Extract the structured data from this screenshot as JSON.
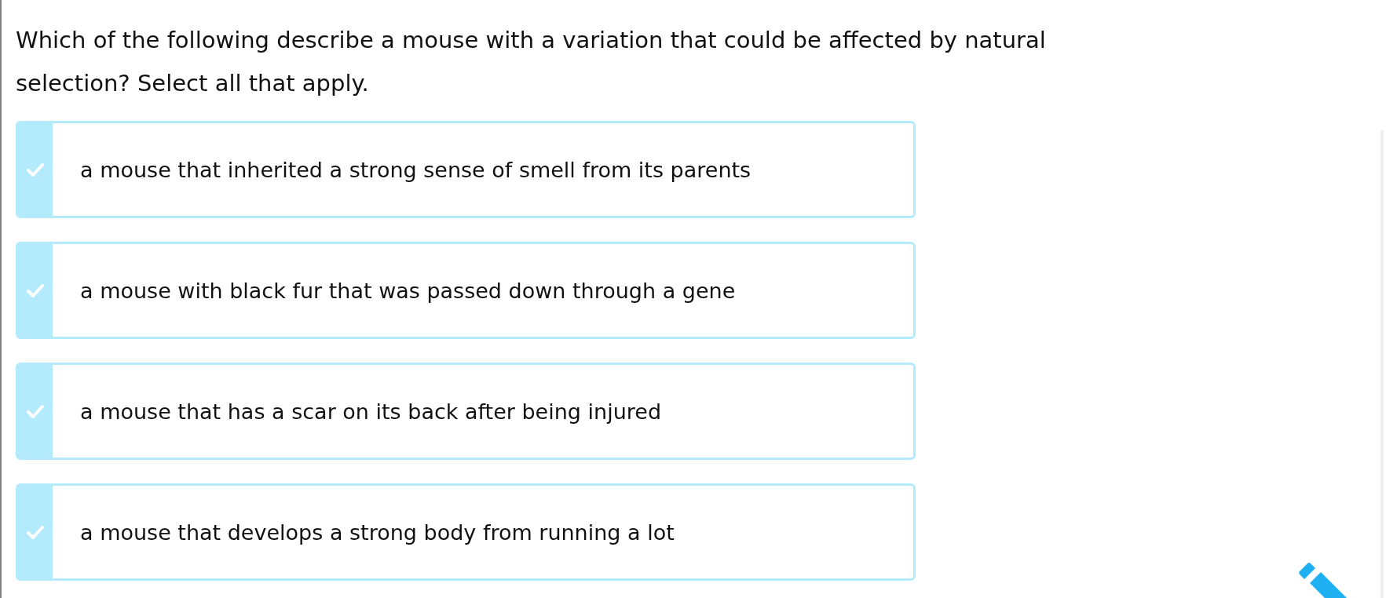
{
  "question": "Which of the following describe a mouse with a variation that could be affected by natural selection? Select all that apply.",
  "choices": [
    {
      "label": "a mouse that inherited a strong sense of smell from its parents",
      "selected": false
    },
    {
      "label": "a mouse with black fur that was passed down through a gene",
      "selected": false
    },
    {
      "label": "a mouse that has a scar on its back after being injured",
      "selected": false
    },
    {
      "label": "a mouse that develops a strong body from running a lot",
      "selected": false
    }
  ]
}
